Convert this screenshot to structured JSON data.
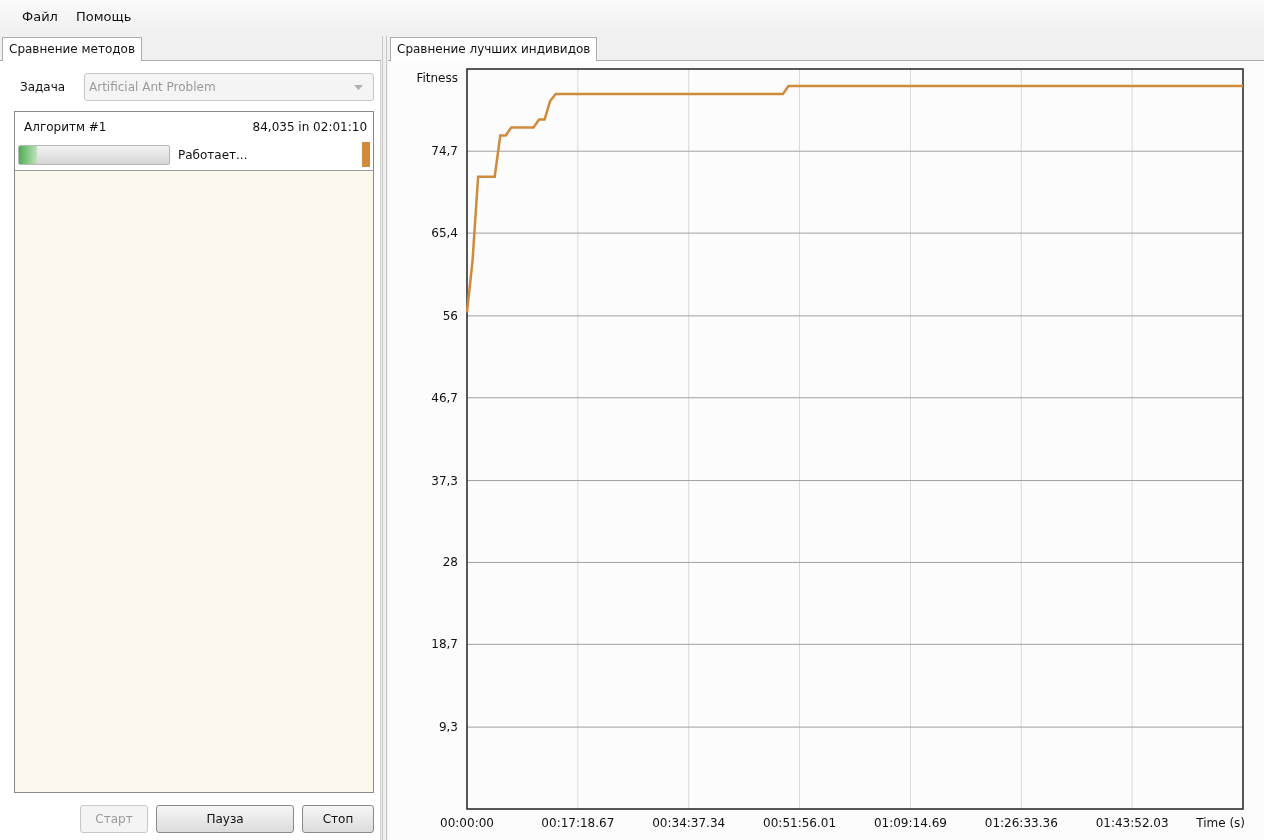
{
  "menu": [
    {
      "label": "Файл"
    },
    {
      "label": "Помощь"
    }
  ],
  "left_panel": {
    "tabs": [
      {
        "label": "Сравнение методов",
        "selected": true
      }
    ],
    "task": {
      "label": "Задача",
      "value": "Artificial Ant Problem",
      "disabled": true
    },
    "algorithms": [
      {
        "name": "Алгоритм #1",
        "result": "84,035 in 02:01:10",
        "level": 0.12,
        "status": "Работает...",
        "color": "#d08a3c"
      }
    ],
    "buttons": [
      {
        "label": "Старт",
        "disabled": true
      },
      {
        "label": "Пауза",
        "disabled": false
      },
      {
        "label": "Стоп",
        "disabled": false
      }
    ]
  },
  "right_panel": {
    "tabs": [
      {
        "label": "Сравнение лучших индивидов",
        "selected": true
      }
    ],
    "chart_data": {
      "type": "line",
      "grid": true,
      "xlabel": "Time (s)",
      "ylabel": "Fitness",
      "ylim": [
        0,
        84.035
      ],
      "categories": [
        "00:00:00",
        null,
        null,
        null,
        null,
        null,
        null,
        null,
        null,
        null,
        null,
        null,
        null,
        null,
        null,
        null,
        null,
        null,
        null,
        null,
        "00:17:18.67",
        null,
        null,
        null,
        null,
        null,
        null,
        null,
        null,
        null,
        null,
        null,
        null,
        null,
        null,
        null,
        null,
        null,
        null,
        null,
        "00:34:37.34",
        null,
        null,
        null,
        null,
        null,
        null,
        null,
        null,
        null,
        null,
        null,
        null,
        null,
        null,
        null,
        null,
        null,
        null,
        null,
        "00:51:56.01",
        null,
        null,
        null,
        null,
        null,
        null,
        null,
        null,
        null,
        null,
        null,
        null,
        null,
        null,
        null,
        null,
        null,
        null,
        null,
        "01:09:14.69",
        null,
        null,
        null,
        null,
        null,
        null,
        null,
        null,
        null,
        null,
        null,
        null,
        null,
        null,
        null,
        null,
        null,
        null,
        null,
        "01:26:33.36",
        null,
        null,
        null,
        null,
        null,
        null,
        null,
        null,
        null,
        null,
        null,
        null,
        null,
        null,
        null,
        null,
        null,
        null,
        null,
        "01:43:52.03",
        null,
        null,
        null,
        null,
        null,
        null,
        null,
        null,
        null,
        null,
        null,
        null,
        null,
        null,
        null,
        null,
        null,
        null,
        null,
        null
      ],
      "yticks": [
        {
          "value": 9.3,
          "label": "9,3"
        },
        {
          "value": 18.7,
          "label": "18,7"
        },
        {
          "value": 28,
          "label": "28"
        },
        {
          "value": 37.3,
          "label": "37,3"
        },
        {
          "value": 46.7,
          "label": "46,7"
        },
        {
          "value": 56,
          "label": "56"
        },
        {
          "value": 65.4,
          "label": "65,4"
        },
        {
          "value": 74.7,
          "label": "74,7"
        }
      ],
      "series": [
        {
          "color": "#d08a3c",
          "values": [
            56.4,
            62.2,
            71.8,
            71.8,
            71.8,
            71.8,
            76.5,
            76.5,
            77.4,
            77.4,
            77.4,
            77.4,
            77.4,
            78.3,
            78.3,
            80.4,
            81.2,
            81.2,
            81.2,
            81.2,
            81.2,
            81.2,
            81.2,
            81.2,
            81.2,
            81.2,
            81.2,
            81.2,
            81.2,
            81.2,
            81.2,
            81.2,
            81.2,
            81.2,
            81.2,
            81.2,
            81.2,
            81.2,
            81.2,
            81.2,
            81.2,
            81.2,
            81.2,
            81.2,
            81.2,
            81.2,
            81.2,
            81.2,
            81.2,
            81.2,
            81.2,
            81.2,
            81.2,
            81.2,
            81.2,
            81.2,
            81.2,
            81.2,
            82.1,
            82.1,
            82.1,
            82.1,
            82.1,
            82.1,
            82.1,
            82.1,
            82.1,
            82.1,
            82.1,
            82.1,
            82.1,
            82.1,
            82.1,
            82.1,
            82.1,
            82.1,
            82.1,
            82.1,
            82.1,
            82.1,
            82.1,
            82.1,
            82.1,
            82.1,
            82.1,
            82.1,
            82.1,
            82.1,
            82.1,
            82.1,
            82.1,
            82.1,
            82.1,
            82.1,
            82.1,
            82.1,
            82.1,
            82.1,
            82.1,
            82.1,
            82.1,
            82.1,
            82.1,
            82.1,
            82.1,
            82.1,
            82.1,
            82.1,
            82.1,
            82.1,
            82.1,
            82.1,
            82.1,
            82.1,
            82.1,
            82.1,
            82.1,
            82.1,
            82.1,
            82.1,
            82.1,
            82.1,
            82.1,
            82.1,
            82.1,
            82.1,
            82.1,
            82.1,
            82.1,
            82.1,
            82.1,
            82.1,
            82.1,
            82.1,
            82.1,
            82.1,
            82.1,
            82.1,
            82.1,
            82.1,
            82.1
          ]
        }
      ]
    }
  }
}
